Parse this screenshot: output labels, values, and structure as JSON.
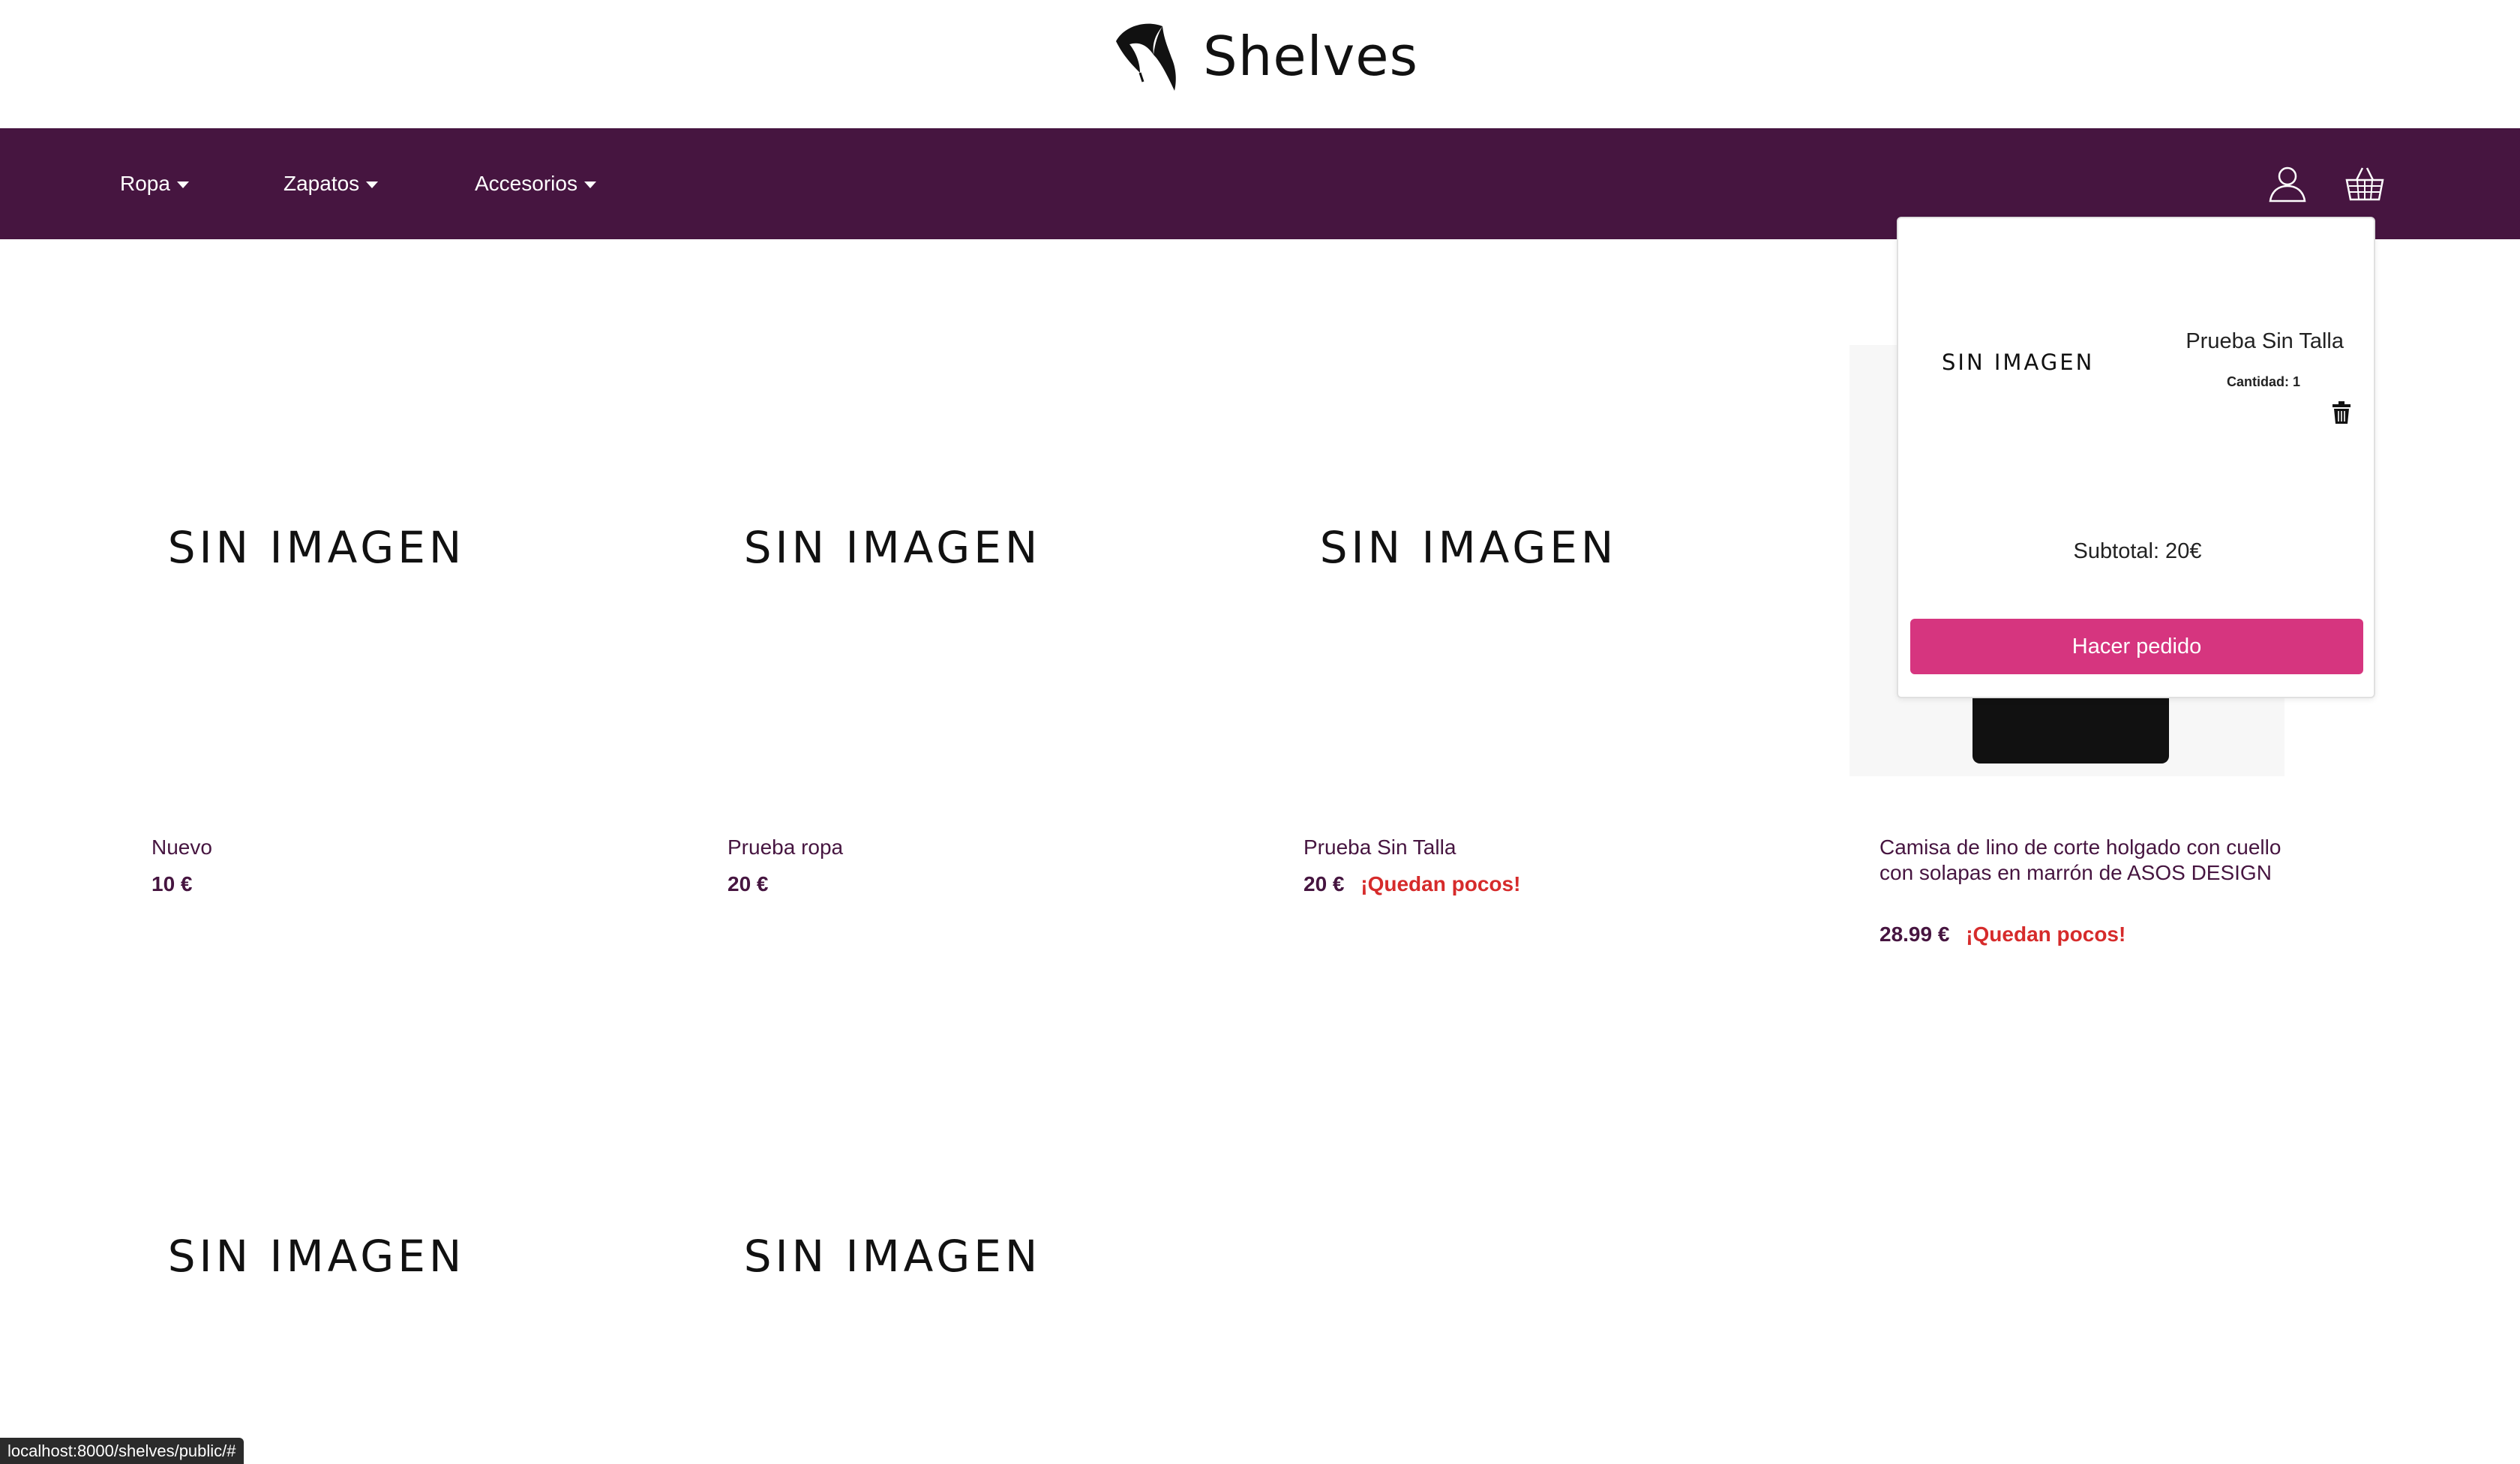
{
  "brand": {
    "name": "Shelves",
    "logo_icon": "leaf-logo-icon"
  },
  "nav": {
    "items": [
      {
        "label": "Ropa"
      },
      {
        "label": "Zapatos"
      },
      {
        "label": "Accesorios"
      }
    ],
    "user_icon": "user-icon",
    "cart_icon": "basket-icon",
    "bg_color": "#461540"
  },
  "products": [
    {
      "image_text": "SIN IMAGEN",
      "name": "Nuevo",
      "price": "10 €",
      "low_stock": ""
    },
    {
      "image_text": "SIN IMAGEN",
      "name": "Prueba ropa",
      "price": "20 €",
      "low_stock": ""
    },
    {
      "image_text": "SIN IMAGEN",
      "name": "Prueba Sin Talla",
      "price": "20 €",
      "low_stock": "¡Quedan pocos!"
    },
    {
      "image_text": "",
      "name": "Camisa de lino de corte holgado con cuello con solapas en marrón de ASOS DESIGN",
      "price": "28.99 €",
      "low_stock": "¡Quedan pocos!"
    },
    {
      "image_text": "SIN IMAGEN",
      "name": "",
      "price": "",
      "low_stock": ""
    },
    {
      "image_text": "SIN IMAGEN",
      "name": "",
      "price": "",
      "low_stock": ""
    }
  ],
  "cart": {
    "item_image_text": "SIN IMAGEN",
    "item_name": "Prueba Sin Talla",
    "quantity_label": "Cantidad: 1",
    "subtotal": "Subtotal: 20€",
    "order_button": "Hacer pedido",
    "button_color": "#d6357f"
  },
  "status_url": "localhost:8000/shelves/public/#",
  "colors": {
    "accent": "#461540",
    "warning": "#d62b2b"
  }
}
